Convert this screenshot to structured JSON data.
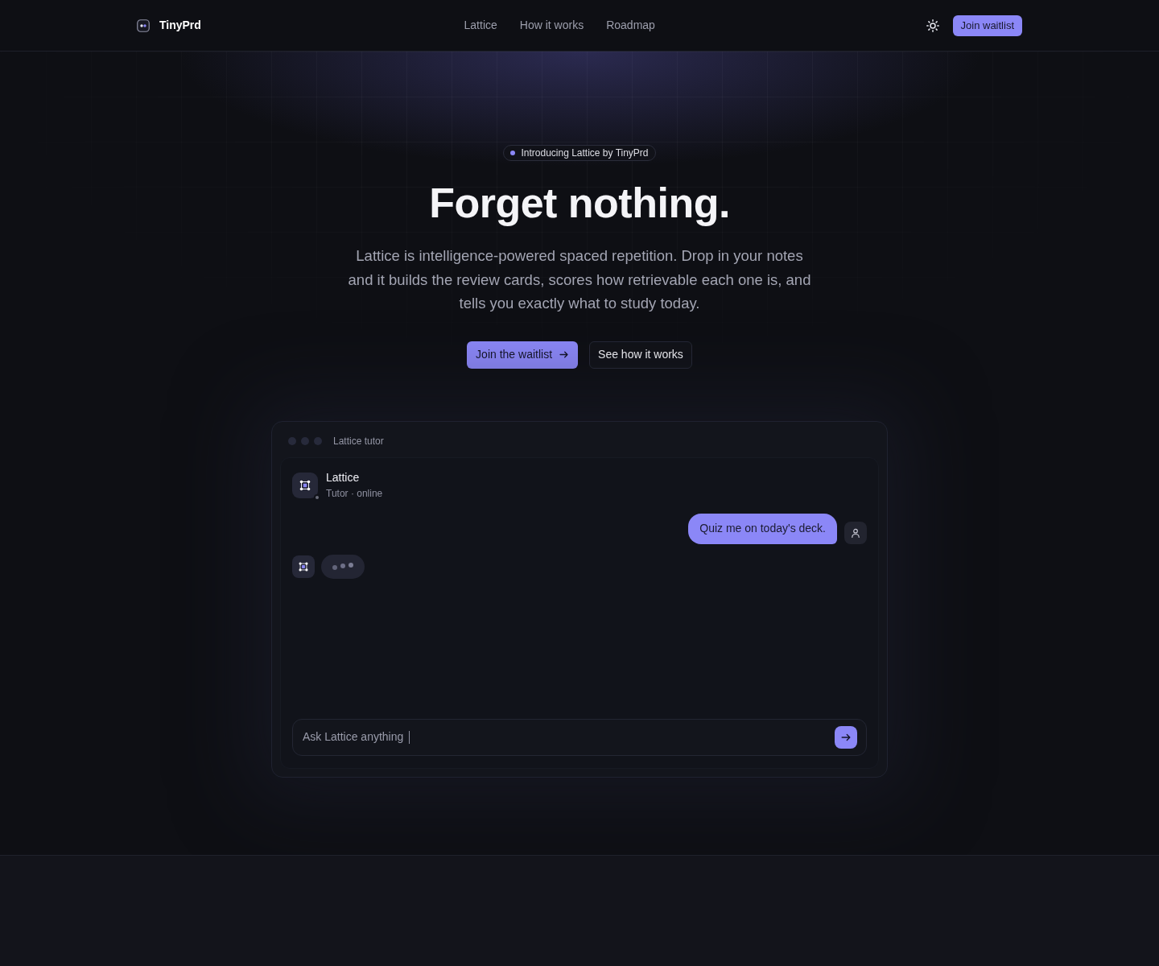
{
  "nav": {
    "brand": "TinyPrd",
    "links": [
      {
        "label": "Lattice"
      },
      {
        "label": "How it works"
      },
      {
        "label": "Roadmap"
      }
    ],
    "cta": "Join waitlist"
  },
  "hero": {
    "badge": "Introducing Lattice by TinyPrd",
    "title": "Forget nothing.",
    "subtitle": "Lattice is intelligence-powered spaced repetition. Drop in your notes and it builds the review cards, scores how retrievable each one is, and tells you exactly what to study today.",
    "buttons": [
      {
        "label": "Join the waitlist",
        "kind": "primary"
      },
      {
        "label": "See how it works",
        "kind": "secondary"
      }
    ]
  },
  "chat": {
    "window_title": "Lattice tutor",
    "bot": {
      "name": "Lattice",
      "status": "Tutor · online"
    },
    "messages": [
      {
        "kind": "user",
        "text": "Quiz me on today's deck."
      },
      {
        "kind": "typing"
      }
    ],
    "input": {
      "placeholder": "Ask Lattice anything"
    }
  }
}
